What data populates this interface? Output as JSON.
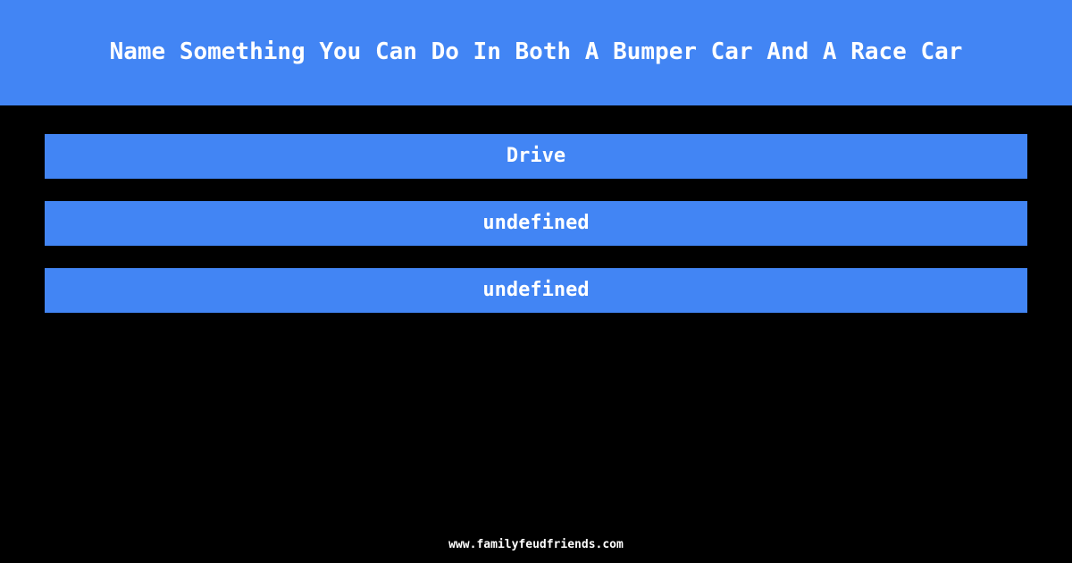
{
  "theme": {
    "background_color": "#000000",
    "accent_color": "#4285f4",
    "text_color": "#ffffff"
  },
  "header": {
    "question": "Name Something You Can Do In Both A Bumper Car And A Race Car"
  },
  "answers": [
    {
      "text": "Drive"
    },
    {
      "text": "undefined"
    },
    {
      "text": "undefined"
    }
  ],
  "footer": {
    "site_url": "www.familyfeudfriends.com"
  }
}
